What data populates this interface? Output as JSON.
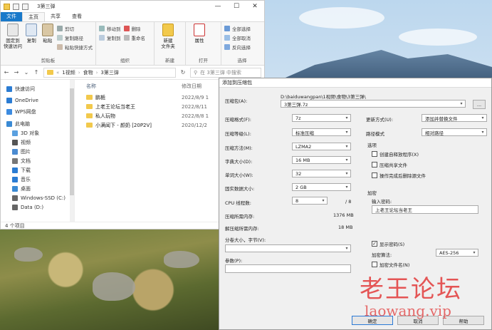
{
  "explorer": {
    "title": "3第三弹",
    "win": {
      "min": "—",
      "max": "☐",
      "close": "✕"
    },
    "tabs": [
      "文件",
      "主页",
      "共享",
      "查看"
    ],
    "ribbon": {
      "clipboard": {
        "label": "剪贴板",
        "pin": "固定到\n快速访问",
        "copy": "复制",
        "paste": "粘贴",
        "cut": "剪切",
        "copy_path": "复制路径",
        "paste_shortcut": "粘贴快捷方式"
      },
      "organize": {
        "label": "组织",
        "move_to": "移动到",
        "copy_to": "复制到",
        "delete": "删除",
        "rename": "重命名"
      },
      "new": {
        "label": "新建",
        "new_folder": "新建\n文件夹"
      },
      "open": {
        "label": "打开",
        "properties": "属性"
      },
      "select": {
        "label": "选择",
        "select_all": "全部选择",
        "select_none": "全部取消",
        "invert": "反向选择"
      }
    },
    "address": {
      "prefix": "«",
      "crumbs": [
        "1视频",
        "食物",
        "3第三弹"
      ]
    },
    "search": {
      "placeholder": "在 3第三弹 中搜索"
    },
    "nav_items": [
      {
        "label": "快速访问",
        "icon": "star-icon",
        "color": "#2b7cd3"
      },
      {
        "label": "OneDrive",
        "icon": "cloud-icon",
        "color": "#2b7cd3"
      },
      {
        "label": "WPS网盘",
        "icon": "cloud-icon",
        "color": "#3c8be0"
      },
      {
        "label": "此电脑",
        "icon": "computer-icon",
        "color": "#3a8ad4"
      },
      {
        "label": "3D 对象",
        "icon": "cube-icon",
        "color": "#5aa0e0"
      },
      {
        "label": "视频",
        "icon": "video-icon",
        "color": "#555555"
      },
      {
        "label": "图片",
        "icon": "image-icon",
        "color": "#4b8bd1"
      },
      {
        "label": "文档",
        "icon": "document-icon",
        "color": "#777777"
      },
      {
        "label": "下载",
        "icon": "download-icon",
        "color": "#2b7cd3"
      },
      {
        "label": "音乐",
        "icon": "music-icon",
        "color": "#2b7cd3"
      },
      {
        "label": "桌面",
        "icon": "desktop-icon",
        "color": "#3a8ad4"
      },
      {
        "label": "Windows-SSD (C:)",
        "icon": "drive-icon",
        "color": "#666666"
      },
      {
        "label": "Data (D:)",
        "icon": "drive-icon",
        "color": "#666666"
      }
    ],
    "columns": {
      "name": "名称",
      "date": "修改日期"
    },
    "files": [
      {
        "name": "鹏栀",
        "date": "2022/8/9 1"
      },
      {
        "name": "上老王论坛当老王",
        "date": "2022/8/11"
      },
      {
        "name": "私人玩物",
        "date": "2022/8/8 1"
      },
      {
        "name": "小满闻下 - 颜奶 [20P2V]",
        "date": "2020/12/2"
      }
    ],
    "status": "4 个项目"
  },
  "dialog": {
    "title": "添加到压缩包",
    "archive_label": "压缩包(A):",
    "archive_dir": "D:\\baiduwangpan\\1视频\\食物\\3第三弹\\",
    "archive_name": "3第三弹.7z",
    "browse": "...",
    "format": {
      "label": "压缩格式(F):",
      "value": "7z"
    },
    "level": {
      "label": "压缩等级(L):",
      "value": "标准压缩"
    },
    "method": {
      "label": "压缩方法(M):",
      "value": "LZMA2"
    },
    "dict": {
      "label": "字典大小(D):",
      "value": "16 MB"
    },
    "word": {
      "label": "单词大小(W):",
      "value": "32"
    },
    "solid": {
      "label": "固实数据大小:",
      "value": "2 GB"
    },
    "threads": {
      "label": "CPU 线程数:",
      "value": "8",
      "max": "/ 8"
    },
    "mem_comp": {
      "label": "压缩所需内存:",
      "value": "1376 MB"
    },
    "mem_decomp": {
      "label": "解压缩所需内存:",
      "value": "18 MB"
    },
    "split": {
      "label": "分卷大小，字节(V):",
      "value": ""
    },
    "params": {
      "label": "参数(P):",
      "value": ""
    },
    "update": {
      "label": "更新方式(U):",
      "value": "添加并替换文件"
    },
    "path_mode": {
      "label": "路径模式",
      "value": "相对路径"
    },
    "options": {
      "label": "选项",
      "sfx": "创建自释放程序(X)",
      "shared": "压缩共享文件",
      "delete_after": "操作完成后删除源文件"
    },
    "encryption": {
      "label": "加密",
      "password_label": "输入密码:",
      "password": "上老王论坛当老王",
      "show_password": "显示密码(S)",
      "method_label": "加密算法:",
      "method": "AES-256",
      "encrypt_names": "加密文件名(N)"
    },
    "buttons": {
      "ok": "确定",
      "cancel": "取消",
      "help": "帮助"
    }
  },
  "watermark": {
    "text": "老王论坛",
    "url": "laowang.vip"
  }
}
